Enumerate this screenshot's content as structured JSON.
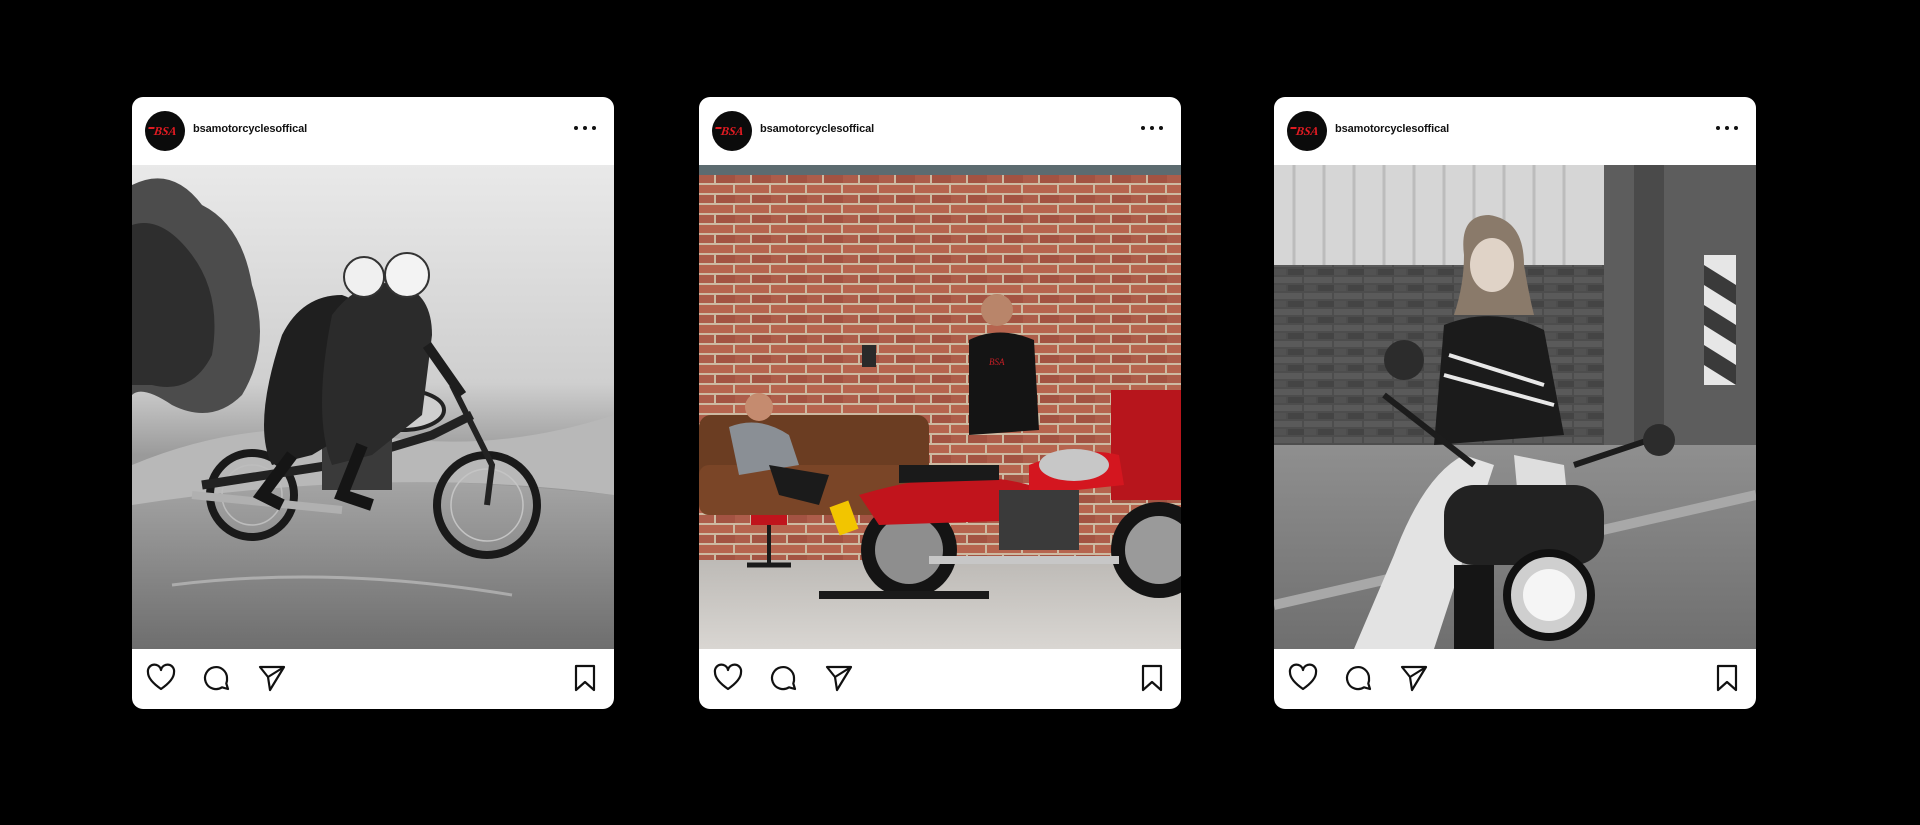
{
  "page": {
    "background": "#000000"
  },
  "posts": [
    {
      "username": "bsamotorcyclesoffical",
      "avatar_text": "BSA",
      "more_icon": "more-horizontal-icon",
      "image_description_icon": "photo",
      "actions": [
        "heart-icon",
        "comment-icon",
        "send-icon",
        "bookmark-icon"
      ]
    },
    {
      "username": "bsamotorcyclesoffical",
      "avatar_text": "BSA",
      "more_icon": "more-horizontal-icon",
      "image_description_icon": "photo",
      "actions": [
        "heart-icon",
        "comment-icon",
        "send-icon",
        "bookmark-icon"
      ]
    },
    {
      "username": "bsamotorcyclesoffical",
      "avatar_text": "BSA",
      "more_icon": "more-horizontal-icon",
      "image_description_icon": "photo",
      "actions": [
        "heart-icon",
        "comment-icon",
        "send-icon",
        "bookmark-icon"
      ]
    }
  ],
  "colors": {
    "brand_red": "#e11b22",
    "card_bg": "#ffffff",
    "icon": "#111111"
  }
}
